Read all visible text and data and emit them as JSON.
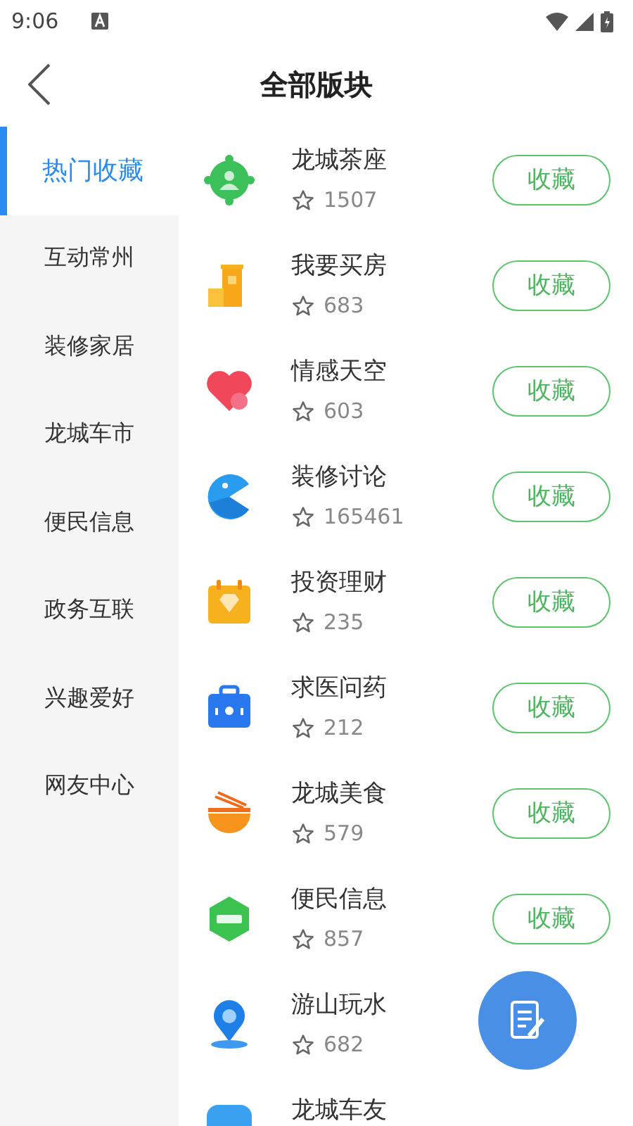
{
  "status_bar": {
    "time": "9:06"
  },
  "header": {
    "title": "全部版块"
  },
  "sidebar": {
    "items": [
      {
        "label": "热门收藏",
        "selected": true
      },
      {
        "label": "互动常州",
        "selected": false
      },
      {
        "label": "装修家居",
        "selected": false
      },
      {
        "label": "龙城车市",
        "selected": false
      },
      {
        "label": "便民信息",
        "selected": false
      },
      {
        "label": "政务互联",
        "selected": false
      },
      {
        "label": "兴趣爱好",
        "selected": false
      },
      {
        "label": "网友中心",
        "selected": false
      }
    ]
  },
  "boards": [
    {
      "title": "龙城茶座",
      "count": "1507",
      "button": "收藏"
    },
    {
      "title": "我要买房",
      "count": "683",
      "button": "收藏"
    },
    {
      "title": "情感天空",
      "count": "603",
      "button": "收藏"
    },
    {
      "title": "装修讨论",
      "count": "165461",
      "button": "收藏"
    },
    {
      "title": "投资理财",
      "count": "235",
      "button": "收藏"
    },
    {
      "title": "求医问药",
      "count": "212",
      "button": "收藏"
    },
    {
      "title": "龙城美食",
      "count": "579",
      "button": "收藏"
    },
    {
      "title": "便民信息",
      "count": "857",
      "button": "收藏"
    },
    {
      "title": "游山玩水",
      "count": "682"
    },
    {
      "title": "龙城车友"
    }
  ]
}
